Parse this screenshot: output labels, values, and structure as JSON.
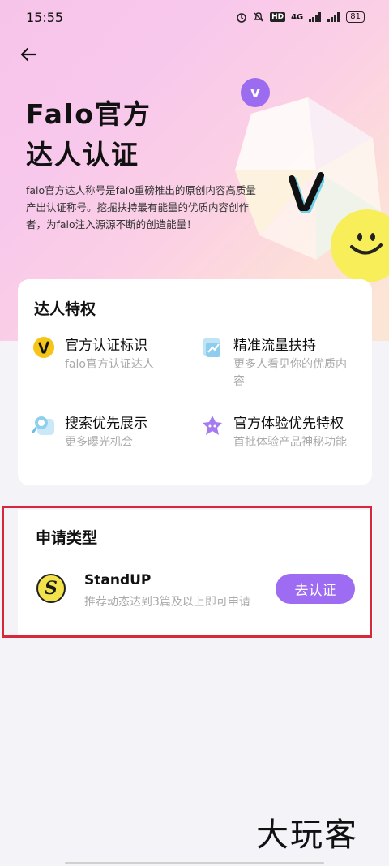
{
  "status_bar": {
    "time": "15:55",
    "network": "4G",
    "battery": "81"
  },
  "hero": {
    "title_line1": "Falo官方",
    "title_line2": "达人认证",
    "description": "falo官方达人称号是falo重磅推出的原创内容高质量产出认证称号。挖掘扶持最有能量的优质内容创作者，为falo注入源源不断的创造能量！",
    "badge_letter": "v"
  },
  "privileges": {
    "title": "达人特权",
    "items": [
      {
        "name": "官方认证标识",
        "desc": "falo官方认证达人",
        "icon": "v-badge-icon"
      },
      {
        "name": "精准流量扶持",
        "desc": "更多人看见你的优质内容",
        "icon": "chart-icon"
      },
      {
        "name": "搜索优先展示",
        "desc": "更多曝光机会",
        "icon": "search-icon"
      },
      {
        "name": "官方体验优先特权",
        "desc": "首批体验产品神秘功能",
        "icon": "star-icon"
      }
    ]
  },
  "apply": {
    "title": "申请类型",
    "app_name": "StandUP",
    "app_logo_letter": "S",
    "requirement": "推荐动态达到3篇及以上即可申请",
    "button": "去认证"
  },
  "watermark": "大玩客",
  "colors": {
    "accent": "#9d6cf2",
    "highlight": "#d6283a",
    "badge_yellow": "#f5c518"
  }
}
